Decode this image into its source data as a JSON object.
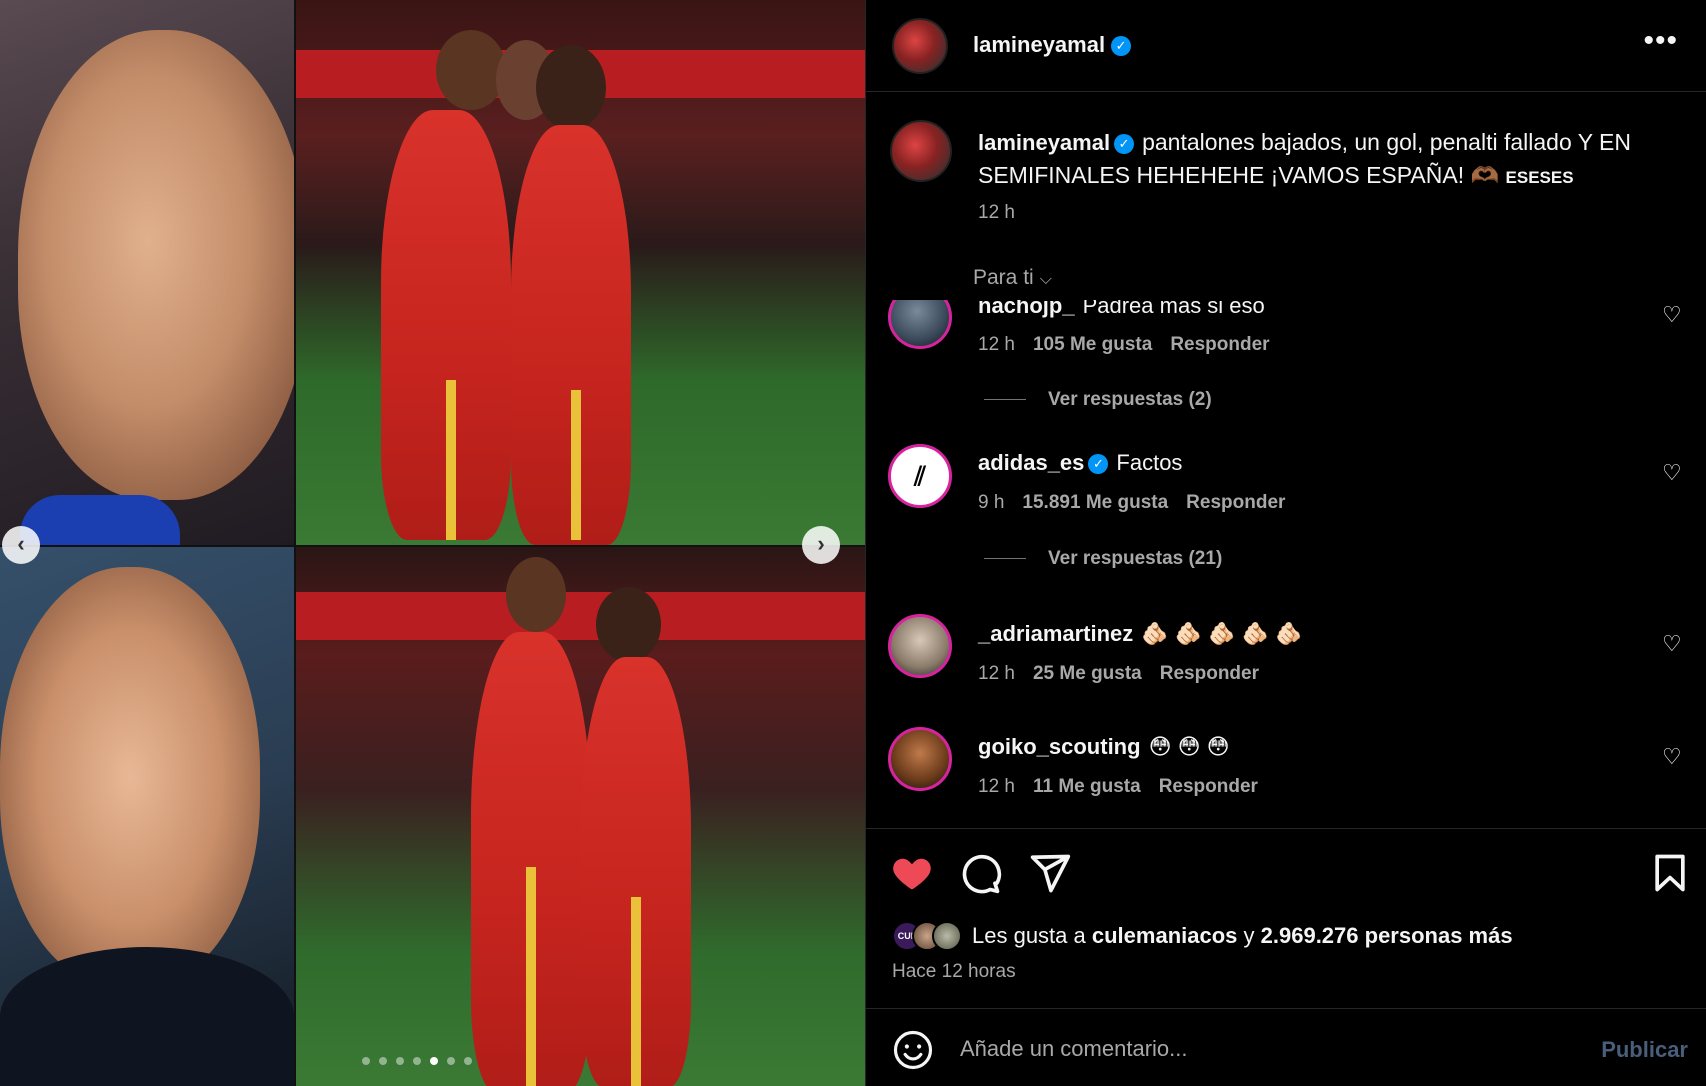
{
  "post": {
    "username": "lamineyamal",
    "more_label": "•••"
  },
  "caption": {
    "username": "lamineyamal",
    "text": "pantalones bajados, un gol, penalti fallado Y EN SEMIFINALES HEHEHEHE ¡VAMOS ESPAÑA! 🫶🏾",
    "suffix": "ESESES",
    "time": "12 h"
  },
  "feed_filter": {
    "label": "Para ti",
    "chevron": "⌵"
  },
  "comments": [
    {
      "username": "nachojp_",
      "text": "Padrea más si eso",
      "time": "12 h",
      "likes": "105 Me gusta",
      "reply": "Responder",
      "replies": "Ver respuestas (2)"
    },
    {
      "username": "adidas_es",
      "text": "Factos",
      "time": "9 h",
      "likes": "15.891 Me gusta",
      "reply": "Responder",
      "replies": "Ver respuestas (21)"
    },
    {
      "username": "_adriamartinez",
      "text": "🫵🏻 🫵🏻 🫵🏻 🫵🏻 🫵🏻",
      "time": "12 h",
      "likes": "25 Me gusta",
      "reply": "Responder"
    },
    {
      "username": "goiko_scouting",
      "text": "😳 😳 😳",
      "time": "12 h",
      "likes": "11 Me gusta",
      "reply": "Responder"
    }
  ],
  "likes": {
    "mini_avatar_text": "CUL",
    "prefix": "Les gusta a",
    "user": "culemaniacos",
    "connector": "y",
    "others": "2.969.276 personas más",
    "time": "Hace 12 horas"
  },
  "add_comment": {
    "placeholder": "Añade un comentario...",
    "publish": "Publicar"
  },
  "carousel": {
    "prev": "‹",
    "next": "›",
    "total_slides": 7,
    "active_slide": 5
  },
  "colors": {
    "like_active": "#ed4956",
    "verified": "#0095f6",
    "publish_disabled": "#4a5d7a"
  }
}
